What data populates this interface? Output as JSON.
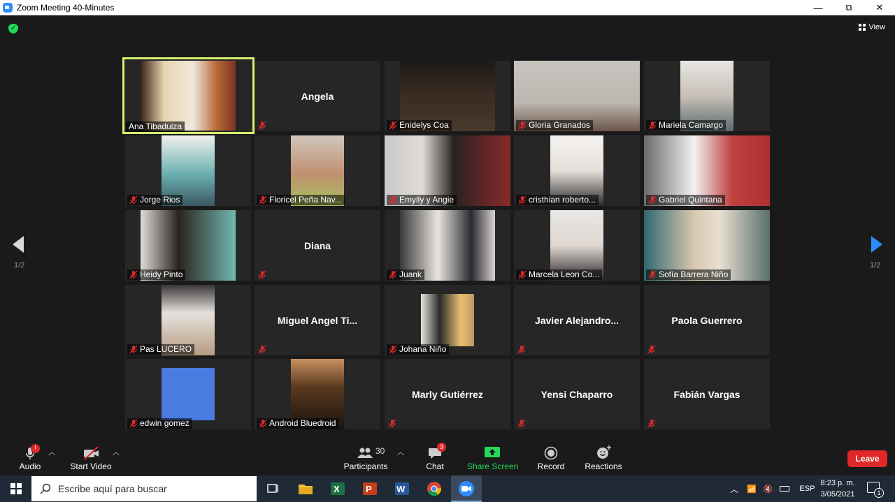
{
  "window": {
    "title": "Zoom Meeting 40-Minutes",
    "minimize": "—",
    "restore": "⧉",
    "close": "✕"
  },
  "top": {
    "view_label": "View"
  },
  "colors": {
    "active_speaker": "#d6f06f",
    "leave": "#e02828",
    "share": "#23d959",
    "mute": "#e02828"
  },
  "pager": {
    "left": "1/2",
    "right": "1/2"
  },
  "participants": [
    {
      "name": "Ana Tibaduiza",
      "video": true,
      "active": true
    },
    {
      "name": "Angela",
      "video": false
    },
    {
      "name": "Enidelys Coa",
      "video": true
    },
    {
      "name": "Gloria Granados",
      "video": true
    },
    {
      "name": "Mariela Camargo",
      "video": true
    },
    {
      "name": "Jorge Rios",
      "video": true
    },
    {
      "name": "Floricel Peña Nav...",
      "video": true
    },
    {
      "name": "Emylly y Angie",
      "video": true
    },
    {
      "name": "cristhian roberto...",
      "video": true
    },
    {
      "name": "Gabriel  Quintana",
      "video": true
    },
    {
      "name": "Heidy Pinto",
      "video": true
    },
    {
      "name": "Diana",
      "video": false
    },
    {
      "name": "Juank",
      "video": true
    },
    {
      "name": "Marcela Leon Co...",
      "video": true
    },
    {
      "name": "Sofía Barrera Niño",
      "video": true
    },
    {
      "name": "Pas LUCERO",
      "video": true
    },
    {
      "name": "Miguel  Angel  Ti...",
      "video": false
    },
    {
      "name": "Johana Niño",
      "video": true
    },
    {
      "name": "Javier  Alejandro...",
      "video": false
    },
    {
      "name": "Paola Guerrero",
      "video": false
    },
    {
      "name": "edwin gomez",
      "video": true
    },
    {
      "name": "Android Bluedroid",
      "video": true
    },
    {
      "name": "Marly Gutiérrez",
      "video": false
    },
    {
      "name": "Yensi Chaparro",
      "video": false
    },
    {
      "name": "Fabián Vargas",
      "video": false
    }
  ],
  "toolbar": {
    "audio": "Audio",
    "audio_badge": "!",
    "video": "Start Video",
    "participants": "Participants",
    "participants_count": "30",
    "chat": "Chat",
    "chat_badge": "3",
    "share": "Share Screen",
    "record": "Record",
    "reactions": "Reactions",
    "leave": "Leave"
  },
  "taskbar": {
    "search_placeholder": "Escribe aquí para buscar",
    "lang": "ESP",
    "time": "8:23 p. m.",
    "date": "3/05/2021",
    "notif_count": "1"
  }
}
